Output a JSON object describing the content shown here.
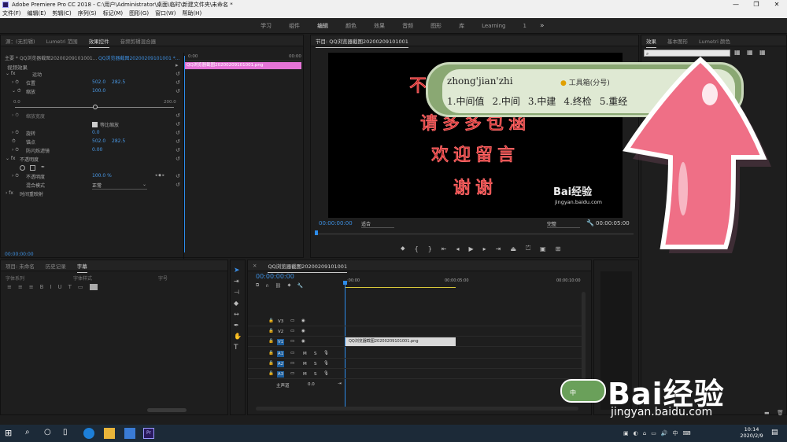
{
  "titlebar": {
    "title": "Adobe Premiere Pro CC 2018 - C:\\用户\\Administrator\\桌面\\临时\\新建文件夹\\未命名 *"
  },
  "menu": [
    "文件(F)",
    "编辑(E)",
    "剪辑(C)",
    "序列(S)",
    "标记(M)",
    "图形(G)",
    "窗口(W)",
    "帮助(H)"
  ],
  "workspaces": [
    "学习",
    "组件",
    "编辑",
    "颜色",
    "效果",
    "音频",
    "图形",
    "库",
    "Learning"
  ],
  "workspace_count": "1",
  "effect_controls": {
    "tabs": [
      "源：(无剪辑)",
      "Lumetri 范围",
      "效果控件",
      "音频剪辑混合器"
    ],
    "master": "主要 * QQ浏览器截图20200209101001...",
    "clip": "QQ浏览器截图20200209101001 *...",
    "tc_start": "0:00",
    "tc_end": "00:00",
    "clip_bar": "QQ浏览器截图20200209101001.png",
    "video_effects": "视频效果",
    "motion": "运动",
    "position": {
      "label": "位置",
      "x": "502.0",
      "y": "282.5"
    },
    "scale": {
      "label": "缩放",
      "value": "100.0"
    },
    "slider_min": "0.0",
    "slider_max": "200.0",
    "scale_width": "缩放宽度",
    "uniform_scale": "等比缩放",
    "rotation": {
      "label": "旋转",
      "value": "0.0"
    },
    "anchor": {
      "label": "锚点",
      "x": "502.0",
      "y": "282.5"
    },
    "anti_flicker": {
      "label": "防闪烁滤镜",
      "value": "0.00"
    },
    "opacity_section": "不透明度",
    "opacity": {
      "label": "不透明度",
      "value": "100.0 %"
    },
    "blend": {
      "label": "混合模式",
      "value": "正常"
    },
    "time_remap": "时间重映射",
    "timecode": "00:00:00:00"
  },
  "program_monitor": {
    "tab": "节目: QQ浏览器截图20200209101001",
    "lines": [
      "不要忘记点赞",
      "请多多包涵",
      "欢迎留言",
      "谢谢"
    ],
    "watermark": "Bai经验",
    "watermark_url": "jingyan.baidu.com",
    "timecode": "00:00:00:00",
    "fit": "适合",
    "quality": "完整",
    "duration": "00:00:05:00"
  },
  "effects_panel": {
    "tabs": [
      "效果",
      "基本图形",
      "Lumetri 颜色"
    ]
  },
  "project_panel": {
    "tabs": [
      "项目: 未命名",
      "历史记录",
      "字幕"
    ],
    "font_placeholder": "字体系列",
    "font_style": "字体样式",
    "size_label": "字号"
  },
  "timeline": {
    "tab": "QQ浏览器截图20200209101001",
    "timecode": "00:00:00:00",
    "ruler": [
      ":00:00",
      "00:00:05:00",
      "00:00:10:00"
    ],
    "video_tracks": [
      "V3",
      "V2",
      "V1"
    ],
    "audio_tracks": [
      "A1",
      "A2",
      "A3"
    ],
    "master": "主声道",
    "master_val": "0.0",
    "clip": "QQ浏览器截图20200209101001.png"
  },
  "ime": {
    "input": "zhong'jian'zhi",
    "toolbox": "工具箱(分号)",
    "candidates": [
      "1.中间值",
      "2.中间",
      "3.中建",
      "4.终检",
      "5.重经"
    ]
  },
  "taskbar": {
    "time": "10:14",
    "date": "2020/2/9",
    "lang": "中"
  },
  "baidu_watermark": {
    "brand": "Bai经验",
    "url": "jingyan.baidu.com",
    "badge": "中"
  },
  "colors": {
    "accent": "#2d8ceb",
    "clip_pink": "#e675d8",
    "ime_green": "#8aa873",
    "arrow_pink": "#ef6f86"
  }
}
